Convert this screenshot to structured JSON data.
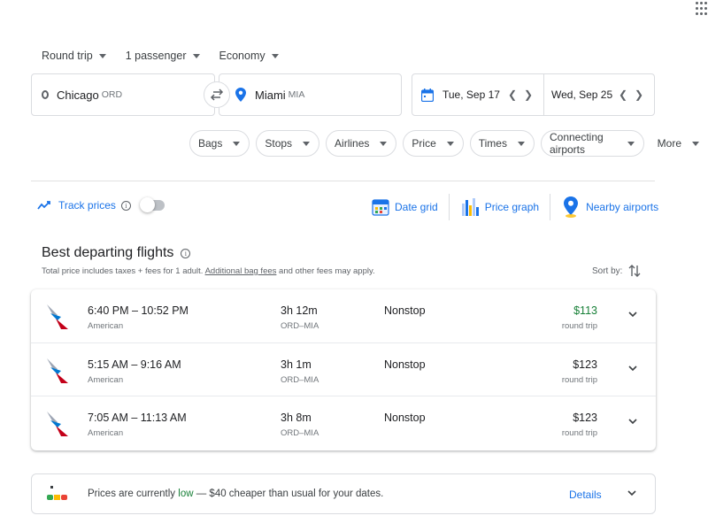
{
  "selectors": {
    "trip_type": "Round trip",
    "passengers": "1 passenger",
    "cabin": "Economy"
  },
  "route": {
    "from_city": "Chicago",
    "from_code": "ORD",
    "to_city": "Miami",
    "to_code": "MIA"
  },
  "dates": {
    "depart": "Tue, Sep 17",
    "return": "Wed, Sep 25"
  },
  "filters": [
    "Bags",
    "Stops",
    "Airlines",
    "Price",
    "Times",
    "Connecting airports",
    "More"
  ],
  "track": {
    "label": "Track prices",
    "info": "i"
  },
  "tools": {
    "date_grid": "Date grid",
    "price_graph": "Price graph",
    "nearby": "Nearby airports"
  },
  "section": {
    "title": "Best departing flights",
    "info": "i",
    "subtext_pre": "Total price includes taxes + fees for 1 adult.",
    "subtext_link": "Additional bag fees",
    "subtext_post": "and other fees may apply.",
    "sort_label": "Sort by:"
  },
  "flights": [
    {
      "times": "6:40 PM – 10:52 PM",
      "airline": "American",
      "duration": "3h 12m",
      "airports": "ORD–MIA",
      "stops": "Nonstop",
      "price": "$113",
      "price_type": "round trip",
      "price_color": "#188038"
    },
    {
      "times": "5:15 AM – 9:16 AM",
      "airline": "American",
      "duration": "3h 1m",
      "airports": "ORD–MIA",
      "stops": "Nonstop",
      "price": "$123",
      "price_type": "round trip",
      "price_color": "#202124"
    },
    {
      "times": "7:05 AM – 11:13 AM",
      "airline": "American",
      "duration": "3h 8m",
      "airports": "ORD–MIA",
      "stops": "Nonstop",
      "price": "$123",
      "price_type": "round trip",
      "price_color": "#202124"
    }
  ],
  "insight": {
    "pre": "Prices are currently",
    "level": "low",
    "post": "— $40 cheaper than usual for your dates.",
    "details": "Details"
  },
  "colors": {
    "accent": "#1a73e8",
    "good_price": "#188038"
  }
}
